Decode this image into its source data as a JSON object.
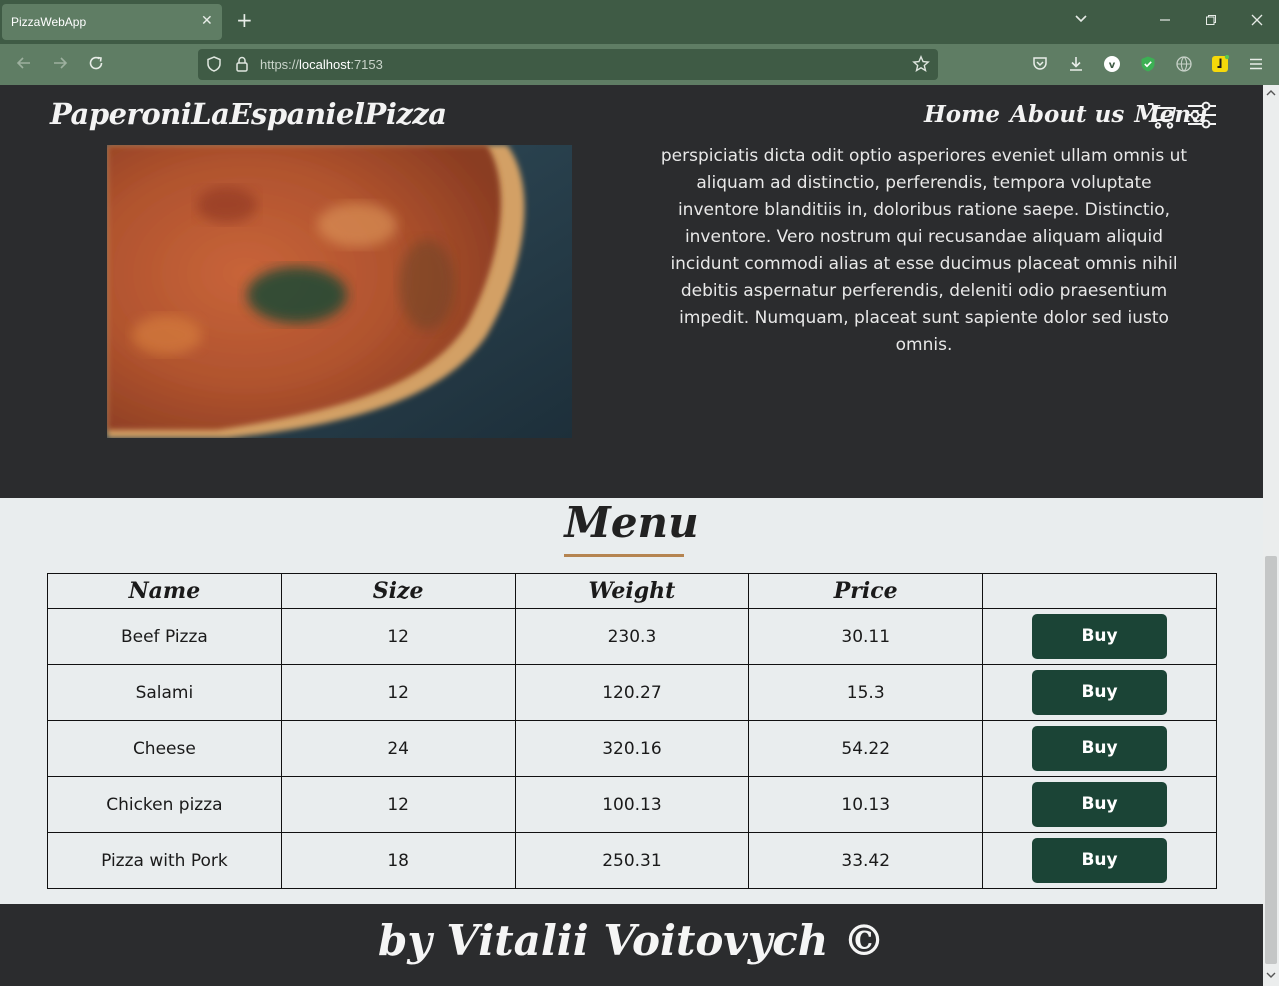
{
  "browser": {
    "tab_title": "PizzaWebApp",
    "tab_close": "✕",
    "new_tab": "+",
    "url_scheme": "https://",
    "url_host": "localhost",
    "url_port": ":7153",
    "icons": [
      "back-arrow-icon",
      "forward-arrow-icon",
      "reload-icon",
      "shield-icon",
      "lock-icon",
      "star-icon",
      "pocket-icon",
      "download-icon",
      "vpn-icon",
      "extension-icon",
      "globe-icon",
      "ext-yellow-icon",
      "app-menu-icon"
    ]
  },
  "header": {
    "brand": "PaperoniLaEspanielPizza",
    "nav": [
      "Home",
      "About us",
      "Menu"
    ]
  },
  "hero": {
    "text": "perspiciatis dicta odit optio asperiores eveniet ullam omnis ut aliquam ad distinctio, perferendis, tempora voluptate inventore blanditiis in, doloribus ratione saepe. Distinctio, inventore. Vero nostrum qui recusandae aliquam aliquid incidunt commodi alias at esse ducimus placeat omnis nihil debitis aspernatur perferendis, deleniti odio praesentium impedit. Numquam, placeat sunt sapiente dolor sed iusto omnis."
  },
  "menu": {
    "title": "Menu",
    "columns": [
      "Name",
      "Size",
      "Weight",
      "Price",
      ""
    ],
    "rows": [
      {
        "name": "Beef Pizza",
        "size": "12",
        "weight": "230.3",
        "price": "30.11",
        "action": "Buy"
      },
      {
        "name": "Salami",
        "size": "12",
        "weight": "120.27",
        "price": "15.3",
        "action": "Buy"
      },
      {
        "name": "Cheese",
        "size": "24",
        "weight": "320.16",
        "price": "54.22",
        "action": "Buy"
      },
      {
        "name": "Chicken pizza",
        "size": "12",
        "weight": "100.13",
        "price": "10.13",
        "action": "Buy"
      },
      {
        "name": "Pizza with Pork",
        "size": "18",
        "weight": "250.31",
        "price": "33.42",
        "action": "Buy"
      }
    ]
  },
  "footer": {
    "text": "by Vitalii Voitovych ©"
  },
  "colors": {
    "chrome_dark": "#3f5b45",
    "chrome_light": "#5f7d64",
    "page_dark": "#2b2c2e",
    "menu_bg": "#e9edee",
    "buy_button": "#1b4436",
    "accent_underline": "#b58450"
  }
}
